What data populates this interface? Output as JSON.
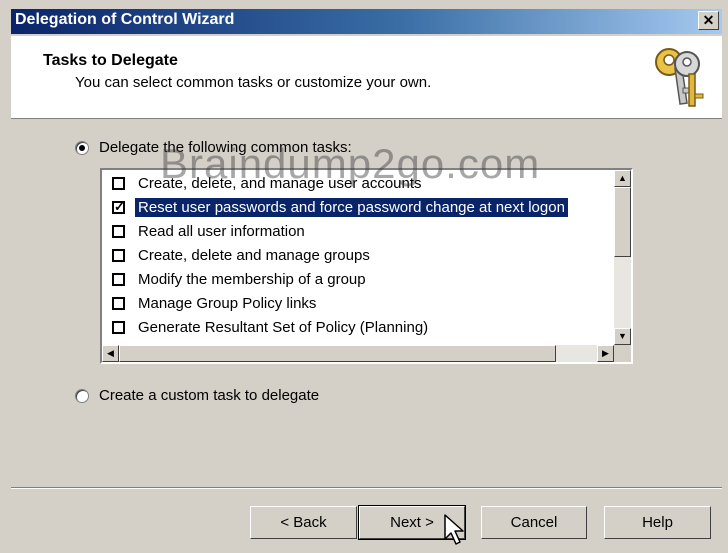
{
  "window": {
    "title": "Delegation of Control Wizard",
    "close_glyph": "✕"
  },
  "header": {
    "title": "Tasks to Delegate",
    "subtitle": "You can select common tasks or customize your own.",
    "icon": "keys-icon"
  },
  "options": {
    "common": {
      "label": "Delegate the following common tasks:",
      "selected": true
    },
    "custom": {
      "label": "Create a custom task to delegate",
      "selected": false
    }
  },
  "tasks": [
    {
      "label": "Create, delete, and manage user accounts",
      "checked": false,
      "highlighted": false
    },
    {
      "label": "Reset user passwords and force password change at next logon",
      "checked": true,
      "highlighted": true
    },
    {
      "label": "Read all user information",
      "checked": false,
      "highlighted": false
    },
    {
      "label": "Create, delete and manage groups",
      "checked": false,
      "highlighted": false
    },
    {
      "label": "Modify the membership of a group",
      "checked": false,
      "highlighted": false
    },
    {
      "label": "Manage Group Policy links",
      "checked": false,
      "highlighted": false
    },
    {
      "label": "Generate Resultant Set of Policy (Planning)",
      "checked": false,
      "highlighted": false
    }
  ],
  "watermark": "Braindump2go.com",
  "buttons": {
    "back": "< Back",
    "next": "Next >",
    "cancel": "Cancel",
    "help": "Help"
  },
  "colors": {
    "selection": "#0a246a",
    "title_bar": "#0a246a",
    "face": "#d4d0c8"
  }
}
